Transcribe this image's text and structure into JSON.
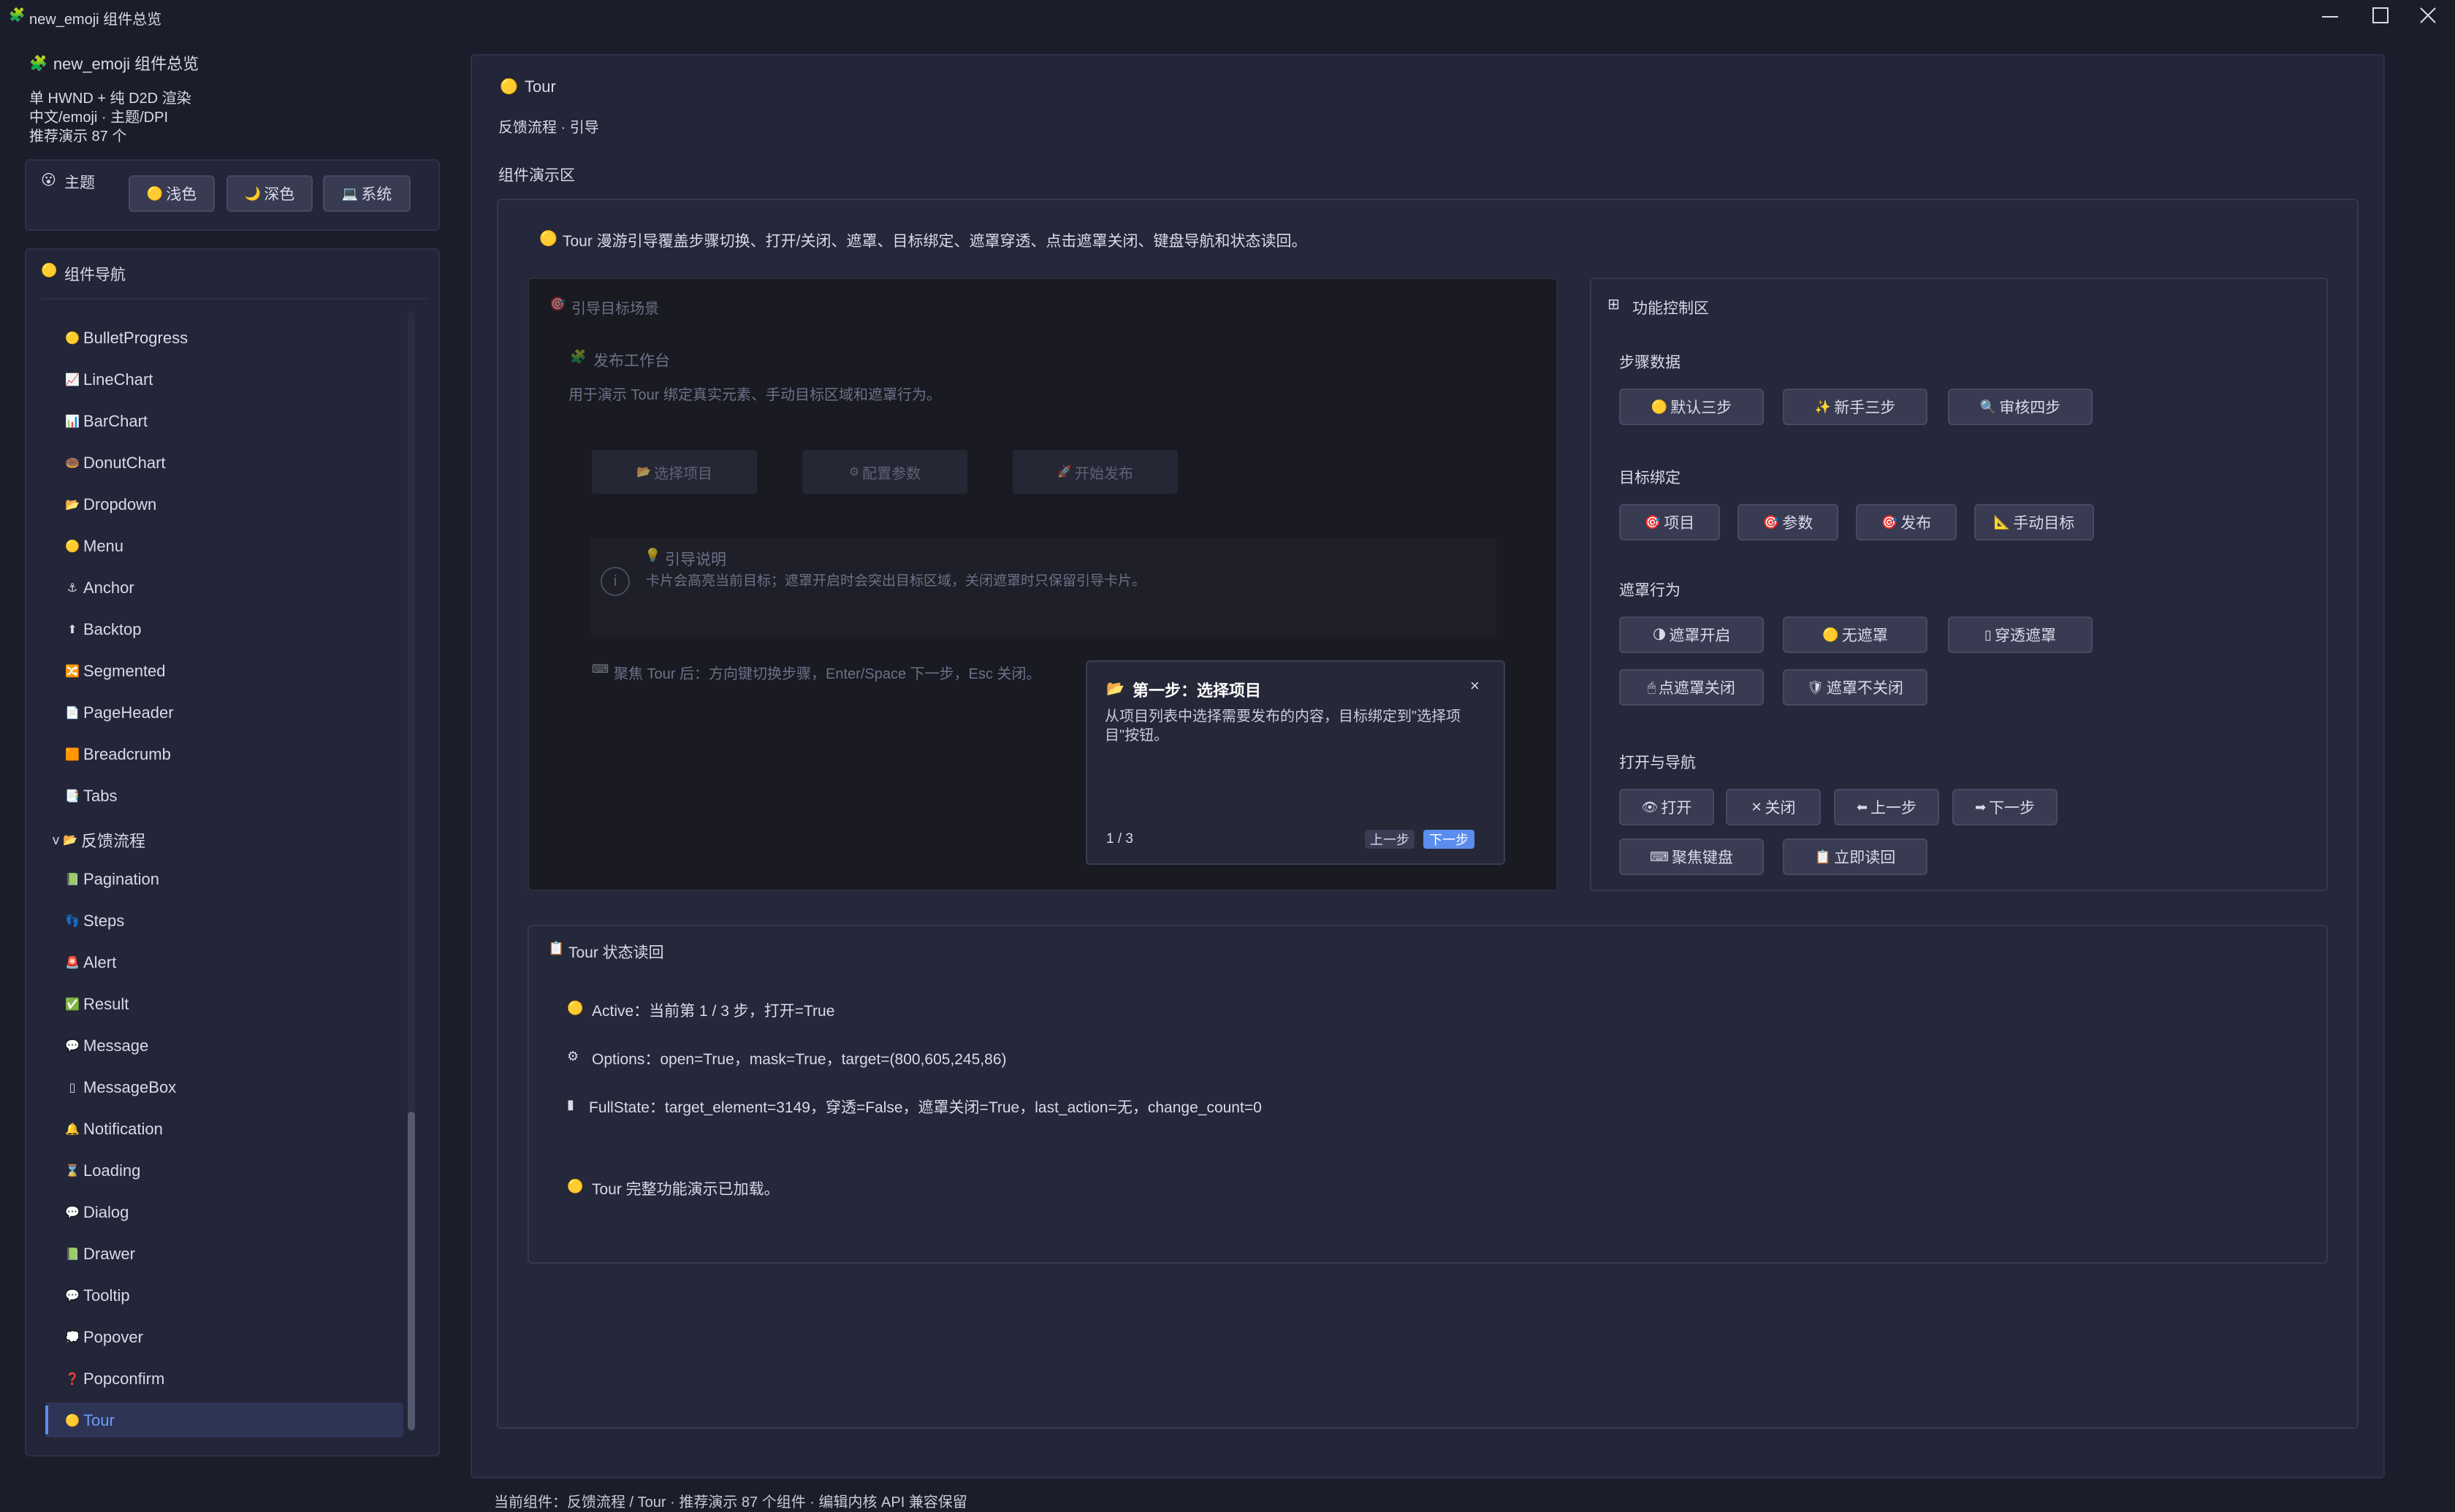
{
  "window": {
    "title": "new_emoji 组件总览",
    "icon": "puzzle-icon"
  },
  "sidebar": {
    "app_title": "new_emoji 组件总览",
    "info_lines": [
      "单 HWND + 纯 D2D 渲染",
      "中文/emoji · 主题/DPI",
      "推荐演示 87 个"
    ],
    "theme_label": "主题",
    "theme_buttons": [
      {
        "icon": "🟡",
        "label": "浅色"
      },
      {
        "icon": "🌙",
        "label": "深色"
      },
      {
        "icon": "💻",
        "label": "系统"
      }
    ],
    "nav_title": "组件导航",
    "nav_items": [
      {
        "icon": "🟡",
        "label": "BulletProgress"
      },
      {
        "icon": "📈",
        "label": "LineChart"
      },
      {
        "icon": "📊",
        "label": "BarChart"
      },
      {
        "icon": "🍩",
        "label": "DonutChart"
      },
      {
        "icon": "📂",
        "label": "Dropdown"
      },
      {
        "icon": "🟡",
        "label": "Menu"
      },
      {
        "icon": "⚓",
        "label": "Anchor"
      },
      {
        "icon": "⬆",
        "label": "Backtop"
      },
      {
        "icon": "🔀",
        "label": "Segmented"
      },
      {
        "icon": "📄",
        "label": "PageHeader"
      },
      {
        "icon": "🟧",
        "label": "Breadcrumb"
      },
      {
        "icon": "📑",
        "label": "Tabs"
      },
      {
        "icon": "📂",
        "label": "反馈流程",
        "group": true,
        "expand": "v"
      },
      {
        "icon": "📗",
        "label": "Pagination"
      },
      {
        "icon": "👣",
        "label": "Steps"
      },
      {
        "icon": "🚨",
        "label": "Alert"
      },
      {
        "icon": "✅",
        "label": "Result"
      },
      {
        "icon": "💬",
        "label": "Message"
      },
      {
        "icon": "▯",
        "label": "MessageBox"
      },
      {
        "icon": "🔔",
        "label": "Notification"
      },
      {
        "icon": "⌛",
        "label": "Loading"
      },
      {
        "icon": "💬",
        "label": "Dialog"
      },
      {
        "icon": "📗",
        "label": "Drawer"
      },
      {
        "icon": "💬",
        "label": "Tooltip"
      },
      {
        "icon": "💭",
        "label": "Popover"
      },
      {
        "icon": "❓",
        "label": "Popconfirm"
      },
      {
        "icon": "🟡",
        "label": "Tour",
        "selected": true
      }
    ]
  },
  "main": {
    "title": "Tour",
    "subtitle": "反馈流程 · 引导",
    "demo_area_label": "组件演示区",
    "intro": "Tour 漫游引导覆盖步骤切换、打开/关闭、遮罩、目标绑定、遮罩穿透、点击遮罩关闭、键盘导航和状态读回。",
    "scene": {
      "title": "引导目标场景",
      "workspace_title": "发布工作台",
      "workspace_desc": "用于演示 Tour 绑定真实元素、手动目标区域和遮罩行为。",
      "buttons": [
        {
          "icon": "📂",
          "label": "选择项目"
        },
        {
          "icon": "⚙",
          "label": "配置参数"
        },
        {
          "icon": "🚀",
          "label": "开始发布"
        }
      ],
      "guide_title": "引导说明",
      "guide_text": "卡片会高亮当前目标；遮罩开启时会突出目标区域，关闭遮罩时只保留引导卡片。",
      "keyboard_hint": "聚焦 Tour 后：方向键切换步骤，Enter/Space 下一步，Esc 关闭。"
    },
    "tour_card": {
      "title": "第一步：选择项目",
      "body": "从项目列表中选择需要发布的内容，目标绑定到\"选择项目\"按钮。",
      "counter": "1 / 3",
      "prev_label": "上一步",
      "next_label": "下一步",
      "close_label": "×"
    },
    "controls": {
      "title": "功能控制区",
      "step_data_label": "步骤数据",
      "step_data_buttons": [
        {
          "icon": "🟡",
          "label": "默认三步"
        },
        {
          "icon": "✨",
          "label": "新手三步"
        },
        {
          "icon": "🔍",
          "label": "审核四步"
        }
      ],
      "target_label": "目标绑定",
      "target_buttons": [
        {
          "icon": "🎯",
          "label": "项目"
        },
        {
          "icon": "🎯",
          "label": "参数"
        },
        {
          "icon": "🎯",
          "label": "发布"
        },
        {
          "icon": "📐",
          "label": "手动目标"
        }
      ],
      "mask_label": "遮罩行为",
      "mask_buttons": [
        {
          "icon": "🌗",
          "label": "遮罩开启"
        },
        {
          "icon": "🟡",
          "label": "无遮罩"
        },
        {
          "icon": "▯",
          "label": "穿透遮罩"
        },
        {
          "icon": "🖱",
          "label": "点遮罩关闭"
        },
        {
          "icon": "🛡",
          "label": "遮罩不关闭"
        }
      ],
      "nav_label": "打开与导航",
      "nav_buttons": [
        {
          "icon": "👁",
          "label": "打开"
        },
        {
          "icon": "✕",
          "label": "关闭"
        },
        {
          "icon": "⬅",
          "label": "上一步"
        },
        {
          "icon": "➡",
          "label": "下一步"
        },
        {
          "icon": "⌨",
          "label": "聚焦键盘"
        },
        {
          "icon": "📋",
          "label": "立即读回"
        }
      ]
    },
    "status": {
      "title": "Tour 状态读回",
      "lines": [
        {
          "icon": "🟡",
          "text": "Active：当前第 1 / 3 步，打开=True"
        },
        {
          "icon": "⚙",
          "text": "Options：open=True，mask=True，target=(800,605,245,86)"
        },
        {
          "icon": "▮",
          "text": "FullState：target_element=3149，穿透=False，遮罩关闭=True，last_action=无，change_count=0"
        }
      ],
      "loaded": {
        "icon": "🟡",
        "text": "Tour 完整功能演示已加载。"
      }
    }
  },
  "statusbar": "当前组件：反馈流程 / Tour · 推荐演示 87 个组件 · 编辑内核 API 兼容保留",
  "colors": {
    "background": "#1c1d2b",
    "panel": "#232538",
    "accent": "#5b8def",
    "button": "#383b52"
  }
}
